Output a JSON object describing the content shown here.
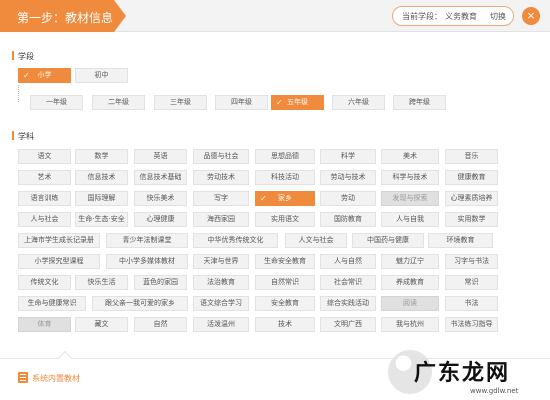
{
  "header": {
    "step_title": "第一步：教材信息",
    "current_label": "当前学段：",
    "current_value": "义务教育",
    "switch_label": "切换",
    "close_symbol": "×",
    "accent_color": "#f08a3c"
  },
  "stage": {
    "title": "学段",
    "options": [
      {
        "label": "小学",
        "selected": true
      },
      {
        "label": "初中",
        "selected": false
      }
    ]
  },
  "grades": [
    {
      "label": "一年级",
      "selected": false
    },
    {
      "label": "二年级",
      "selected": false
    },
    {
      "label": "三年级",
      "selected": false
    },
    {
      "label": "四年级",
      "selected": false
    },
    {
      "label": "五年级",
      "selected": true
    },
    {
      "label": "六年级",
      "selected": false
    },
    {
      "label": "跨年级",
      "selected": false
    }
  ],
  "subjects": {
    "title": "学科",
    "rows": [
      [
        "语文",
        "数学",
        "英语",
        "品德与社会",
        "思想品德",
        "科学",
        "美术",
        "音乐"
      ],
      [
        "艺术",
        "信息技术",
        "信息技术基础",
        "劳动技术",
        "科技活动",
        "劳动与技术",
        "科学与技术",
        "健康教育"
      ],
      [
        "语言训练",
        "国际理解",
        "快乐美术",
        "写字",
        "家乡",
        "劳动",
        "发现与探索",
        "心理素质培养"
      ],
      [
        "人与社会",
        "生命·生态·安全",
        "心理健康",
        "海西家园",
        "实用语文",
        "国防教育",
        "人与自我",
        "实用数学"
      ],
      [
        "上海市学生成长记录册",
        "青少年法制课堂",
        "中华优秀传统文化",
        "人文与社会",
        "中国药与健康",
        "环境教育"
      ],
      [
        "小学探究型课程",
        "中小学多媒体教材",
        "天津与世界",
        "生命安全教育",
        "人与自然",
        "魅力辽宁",
        "习字与书法"
      ],
      [
        "传统文化",
        "快乐生活",
        "蓝色的家园",
        "法治教育",
        "自然常识",
        "社会常识",
        "养成教育",
        "常识"
      ],
      [
        "生命与健康常识",
        "跟父亲一我可爱的家乡",
        "语文综合学习",
        "安全教育",
        "综合实践活动",
        "阅读",
        "书法"
      ],
      [
        "体育",
        "藏文",
        "自然",
        "活泼温州",
        "技术",
        "文明广西",
        "我与杭州",
        "书法练习指导"
      ]
    ],
    "selected": "家乡",
    "greyed": [
      "发现与探索",
      "阅读",
      "体育"
    ]
  },
  "footer": {
    "label": "系统内置教材"
  },
  "watermark": {
    "text": "广东龙网",
    "url": "www.gdlw.net"
  }
}
